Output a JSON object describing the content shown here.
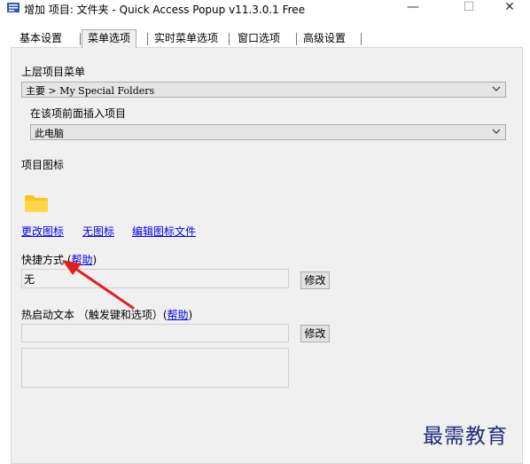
{
  "window": {
    "title": "增加 项目: 文件夹 - Quick Access Popup v11.3.0.1 Free",
    "controls": {
      "minimize": "—",
      "maximize": "☐",
      "close": "✕"
    }
  },
  "tabs": [
    {
      "label": "基本设置",
      "active": false
    },
    {
      "label": "菜单选项",
      "active": true
    },
    {
      "label": "实时菜单选项",
      "active": false
    },
    {
      "label": "窗口选项",
      "active": false
    },
    {
      "label": "高级设置",
      "active": false
    }
  ],
  "menu_options": {
    "parent_menu_label": "上层项目菜单",
    "parent_menu_value": "主要 > My Special Folders",
    "insert_before_label": "在该项前面插入项目",
    "insert_before_value": "此电脑",
    "icon_label": "项目图标",
    "icon_name": "folder-icon",
    "icon_color": "#f9c522",
    "icon_links": {
      "change": "更改图标",
      "none": "无图标",
      "edit_file": "编辑图标文件"
    },
    "shortcut_label": "快捷方式 (",
    "shortcut_help": "帮助",
    "shortcut_label_end": ")",
    "shortcut_value": "无",
    "shortcut_modify": "修改",
    "hotstring_label": "热启动文本 （触发键和选项）(",
    "hotstring_help": "帮助",
    "hotstring_label_end": ")",
    "hotstring_value": "",
    "hotstring_modify": "修改",
    "hotstring_options": ""
  },
  "annotation": {
    "arrow_color": "#e02020"
  },
  "watermark": "最需教育"
}
